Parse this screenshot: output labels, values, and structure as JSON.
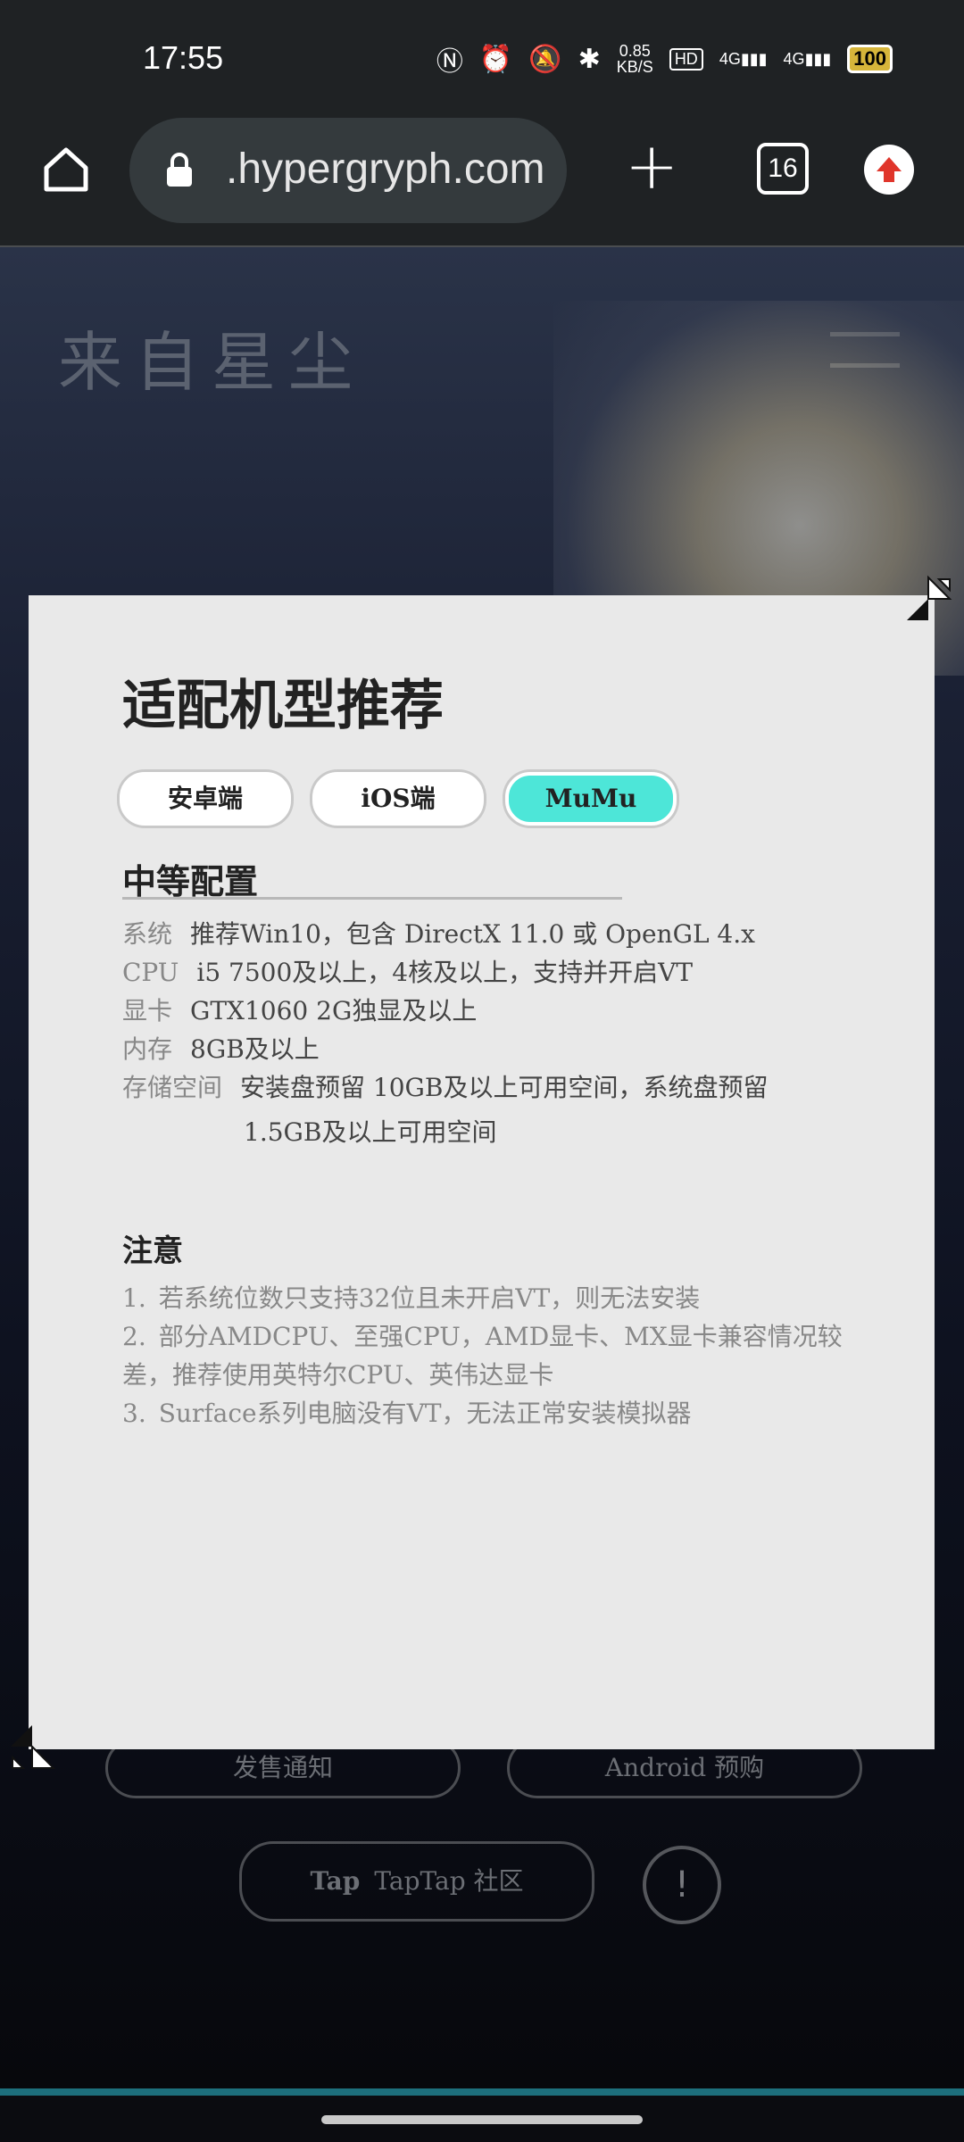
{
  "status_bar": {
    "time": "17:55",
    "speed": "0.85",
    "speed_unit": "KB/S",
    "hd": "HD",
    "net1": "4G",
    "net2": "4G",
    "battery": "100"
  },
  "browser": {
    "url": ".hypergryph.com",
    "tab_count": "16",
    "icons": [
      "home-icon",
      "lock-icon",
      "new-tab-icon",
      "tabs-icon",
      "update-icon"
    ]
  },
  "background_page": {
    "logo_text": "来自星尘",
    "buttons": [
      "发售通知",
      "Android 预购",
      "TapTap 社区"
    ],
    "taptap_logo": "Tap"
  },
  "modal": {
    "title": "适配机型推荐",
    "tabs": [
      {
        "label": "安卓端",
        "active": false
      },
      {
        "label": "iOS端",
        "active": false
      },
      {
        "label": "MuMu",
        "active": true
      }
    ],
    "section_title": "中等配置",
    "specs": [
      {
        "key": "系统",
        "value": "推荐Win10，包含 DirectX 11.0 或 OpenGL 4.x"
      },
      {
        "key": "CPU",
        "value": "i5 7500及以上，4核及以上，支持并开启VT"
      },
      {
        "key": "显卡",
        "value": "GTX1060 2G独显及以上"
      },
      {
        "key": "内存",
        "value": "8GB及以上"
      },
      {
        "key": "存储空间",
        "value": "安装盘预留 10GB及以上可用空间，系统盘预留",
        "value2": "1.5GB及以上可用空间"
      }
    ],
    "notes_title": "注意",
    "notes": [
      {
        "num": "1.",
        "text": "若系统位数只支持32位且未开启VT，则无法安装"
      },
      {
        "num": "2.",
        "text": "部分AMDCPU、至强CPU，AMD显卡、MX显卡兼容情况较差，推荐使用英特尔CPU、英伟达显卡"
      },
      {
        "num": "3.",
        "text": "Surface系列电脑没有VT，无法正常安装模拟器"
      }
    ]
  },
  "colors": {
    "active_tab": "#4de6d8",
    "modal_bg": "#e9e9e9",
    "toolbar_bg": "#1f2224"
  }
}
